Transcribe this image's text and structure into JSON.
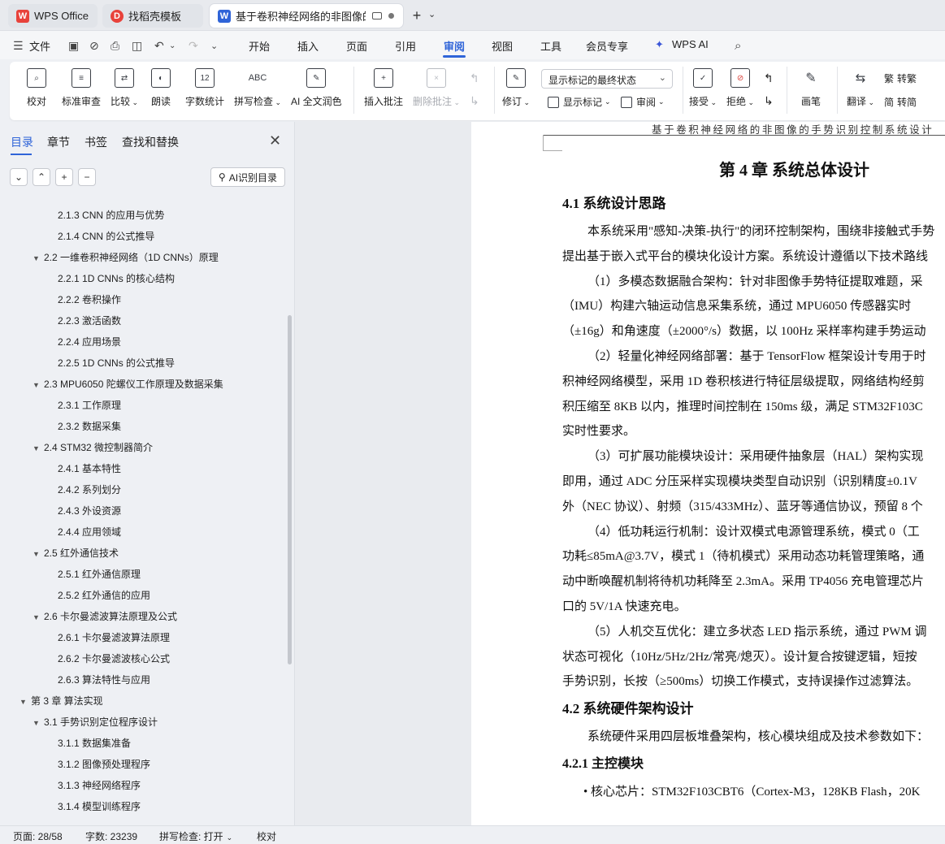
{
  "tabs": [
    {
      "label": "WPS Office",
      "logo": "W",
      "color": "#e8423b"
    },
    {
      "label": "找稻壳模板",
      "logo": "D",
      "color": "#e8423b"
    },
    {
      "label": "基于卷积神经网络的非图像的",
      "logo": "W",
      "color": "#2f64d8"
    }
  ],
  "menu": {
    "file": "文件",
    "items": [
      "开始",
      "插入",
      "页面",
      "引用",
      "审阅",
      "视图",
      "工具",
      "会员专享"
    ],
    "active": "审阅",
    "wps_ai": "WPS AI"
  },
  "ribbon": {
    "proofread": "校对",
    "standard_review": "标准审查",
    "compare": "比较",
    "read_aloud": "朗读",
    "word_count": "字数统计",
    "spell_check": "拼写检查",
    "ai_polish": "AI 全文润色",
    "insert_comment": "插入批注",
    "delete_comment": "删除批注",
    "track_changes": "修订",
    "markup_select": "显示标记的最终状态",
    "show_markup": "显示标记",
    "review_pane": "审阅",
    "accept": "接受",
    "reject": "拒绝",
    "pen": "画笔",
    "translate": "翻译",
    "to_traditional": "转繁",
    "to_simplified": "转简",
    "abc_icon_text": "ABC",
    "word_count_icon_text": "12"
  },
  "panel": {
    "tabs": [
      "目录",
      "章节",
      "书签",
      "查找和替换"
    ],
    "ai_toc": "AI识别目录",
    "toc": [
      {
        "level": 3,
        "text": "2.1.3 CNN 的应用与优势"
      },
      {
        "level": 3,
        "text": "2.1.4 CNN 的公式推导"
      },
      {
        "level": 2,
        "text": "2.2  一维卷积神经网络（1D CNNs）原理",
        "expanded": true
      },
      {
        "level": 3,
        "text": "2.2.1 1D CNNs 的核心结构"
      },
      {
        "level": 3,
        "text": "2.2.2  卷积操作"
      },
      {
        "level": 3,
        "text": "2.2.3  激活函数"
      },
      {
        "level": 3,
        "text": "2.2.4  应用场景"
      },
      {
        "level": 3,
        "text": "2.2.5 1D CNNs 的公式推导"
      },
      {
        "level": 2,
        "text": "2.3 MPU6050 陀螺仪工作原理及数据采集",
        "expanded": true
      },
      {
        "level": 3,
        "text": "2.3.1  工作原理"
      },
      {
        "level": 3,
        "text": "2.3.2  数据采集"
      },
      {
        "level": 2,
        "text": "2.4 STM32 微控制器简介",
        "expanded": true
      },
      {
        "level": 3,
        "text": "2.4.1  基本特性"
      },
      {
        "level": 3,
        "text": "2.4.2  系列划分"
      },
      {
        "level": 3,
        "text": "2.4.3  外设资源"
      },
      {
        "level": 3,
        "text": "2.4.4  应用领域"
      },
      {
        "level": 2,
        "text": "2.5  红外通信技术",
        "expanded": true
      },
      {
        "level": 3,
        "text": "2.5.1  红外通信原理"
      },
      {
        "level": 3,
        "text": "2.5.2  红外通信的应用"
      },
      {
        "level": 2,
        "text": "2.6  卡尔曼滤波算法原理及公式",
        "expanded": true
      },
      {
        "level": 3,
        "text": "2.6.1 卡尔曼滤波算法原理"
      },
      {
        "level": 3,
        "text": "2.6.2 卡尔曼滤波核心公式"
      },
      {
        "level": 3,
        "text": "2.6.3 算法特性与应用"
      },
      {
        "level": 1,
        "text": "第 3 章  算法实现",
        "expanded": true
      },
      {
        "level": 2,
        "text": "3.1  手势识别定位程序设计",
        "expanded": true
      },
      {
        "level": 3,
        "text": "3.1.1  数据集准备"
      },
      {
        "level": 3,
        "text": "3.1.2  图像预处理程序"
      },
      {
        "level": 3,
        "text": "3.1.3  神经网络程序"
      },
      {
        "level": 3,
        "text": "3.1.4  模型训练程序"
      }
    ]
  },
  "document": {
    "header": "基于卷积神经网络的非图像的手势识别控制系统设计",
    "chapter_title": "第 4 章  系统总体设计",
    "lines": [
      {
        "style": "h2",
        "text": "4.1  系统设计思路"
      },
      {
        "style": "p",
        "indent": true,
        "text": "本系统采用\"感知-决策-执行\"的闭环控制架构，围绕非接触式手势"
      },
      {
        "style": "p",
        "indent": false,
        "text": "提出基于嵌入式平台的模块化设计方案。系统设计遵循以下技术路线"
      },
      {
        "style": "p",
        "indent": true,
        "text": "（1）多模态数据融合架构：针对非图像手势特征提取难题，采"
      },
      {
        "style": "p",
        "indent": false,
        "text": "（IMU）构建六轴运动信息采集系统，通过 MPU6050 传感器实时"
      },
      {
        "style": "p",
        "indent": false,
        "text": "（±16g）和角速度（±2000°/s）数据，以 100Hz 采样率构建手势运动"
      },
      {
        "style": "p",
        "indent": true,
        "text": "（2）轻量化神经网络部署：基于 TensorFlow 框架设计专用于时"
      },
      {
        "style": "p",
        "indent": false,
        "text": "积神经网络模型，采用 1D 卷积核进行特征层级提取，网络结构经剪"
      },
      {
        "style": "p",
        "indent": false,
        "text": "积压缩至 8KB 以内，推理时间控制在 150ms 级，满足 STM32F103C"
      },
      {
        "style": "p",
        "indent": false,
        "text": "实时性要求。"
      },
      {
        "style": "p",
        "indent": true,
        "text": "（3）可扩展功能模块设计：采用硬件抽象层（HAL）架构实现"
      },
      {
        "style": "p",
        "indent": false,
        "text": "即用，通过 ADC 分压采样实现模块类型自动识别（识别精度±0.1V"
      },
      {
        "style": "p",
        "indent": false,
        "text": "外（NEC 协议）、射频（315/433MHz）、蓝牙等通信协议，预留 8 个"
      },
      {
        "style": "p",
        "indent": true,
        "text": "（4）低功耗运行机制：设计双模式电源管理系统，模式 0（工"
      },
      {
        "style": "p",
        "indent": false,
        "text": "功耗≤85mA@3.7V，模式 1（待机模式）采用动态功耗管理策略，通"
      },
      {
        "style": "p",
        "indent": false,
        "text": "动中断唤醒机制将待机功耗降至 2.3mA。采用 TP4056 充电管理芯片"
      },
      {
        "style": "p",
        "indent": false,
        "text": "口的 5V/1A 快速充电。"
      },
      {
        "style": "p",
        "indent": true,
        "text": "（5）人机交互优化：建立多状态 LED 指示系统，通过 PWM 调"
      },
      {
        "style": "p",
        "indent": false,
        "text": "状态可视化（10Hz/5Hz/2Hz/常亮/熄灭）。设计复合按键逻辑，短按"
      },
      {
        "style": "p",
        "indent": false,
        "text": "手势识别，长按（≥500ms）切换工作模式，支持误操作过滤算法。"
      },
      {
        "style": "h2",
        "text": "4.2  系统硬件架构设计"
      },
      {
        "style": "p",
        "indent": true,
        "text": "系统硬件采用四层板堆叠架构，核心模块组成及技术参数如下："
      },
      {
        "style": "h3",
        "text": "4.2.1  主控模块"
      },
      {
        "style": "p",
        "indent": false,
        "text": " • 核心芯片：STM32F103CBT6（Cortex-M3，128KB Flash，20K"
      }
    ]
  },
  "status": {
    "page": "页面: 28/58",
    "words": "字数: 23239",
    "spell": "拼写检查: 打开",
    "proof": "校对"
  }
}
